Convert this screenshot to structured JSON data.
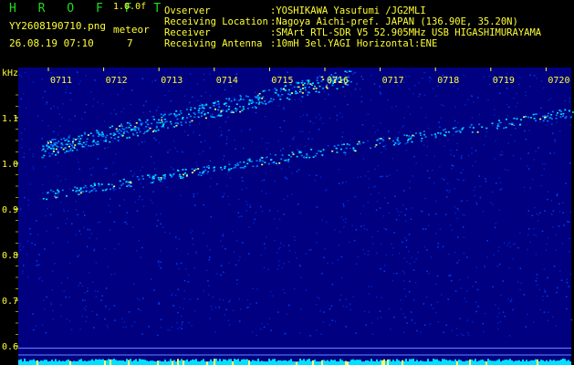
{
  "header": {
    "brand": "H R O F F T",
    "version": "1.0.0f",
    "filename": "YY2608190710.png",
    "datetime": "26.08.19 07:10",
    "meteor_label": "meteor",
    "meteor_count": "7",
    "info": [
      {
        "key": "Ovserver",
        "value": ":YOSHIKAWA Yasufumi /JG2MLI"
      },
      {
        "key": "Receiving Location",
        "value": ":Nagoya Aichi-pref. JAPAN (136.90E, 35.20N)"
      },
      {
        "key": "Receiver",
        "value": ":SMArt RTL-SDR V5 52.905MHz USB HIGASHIMURAYAMA"
      },
      {
        "key": "Receiving Antenna",
        "value": ":10mH 3el.YAGI Horizontal:ENE"
      }
    ]
  },
  "colors": {
    "accent_yellow": "#ffff33",
    "accent_green": "#22dd22",
    "background": "#000080",
    "signal": "#00ddff",
    "baseline": "#00e0ff"
  },
  "chart_data": {
    "type": "heatmap",
    "ylabel": "kHz",
    "y_ticks": [
      "1.1",
      "1.0",
      "0.9",
      "0.8",
      "0.7",
      "0.6"
    ],
    "x_ticks": [
      "0711",
      "0712",
      "0713",
      "0714",
      "0715",
      "0716",
      "0717",
      "0718",
      "0719",
      "0720"
    ],
    "ylim": [
      0.58,
      1.19
    ],
    "tracks": [
      {
        "x_start": 0,
        "x_end": 5.6,
        "y_start": 1.03,
        "y_end": 1.19
      },
      {
        "x_start": 0,
        "x_end": 10,
        "y_start": 0.93,
        "y_end": 1.12
      }
    ],
    "baseline_lines": [
      0.615,
      0.6,
      0.585
    ]
  }
}
